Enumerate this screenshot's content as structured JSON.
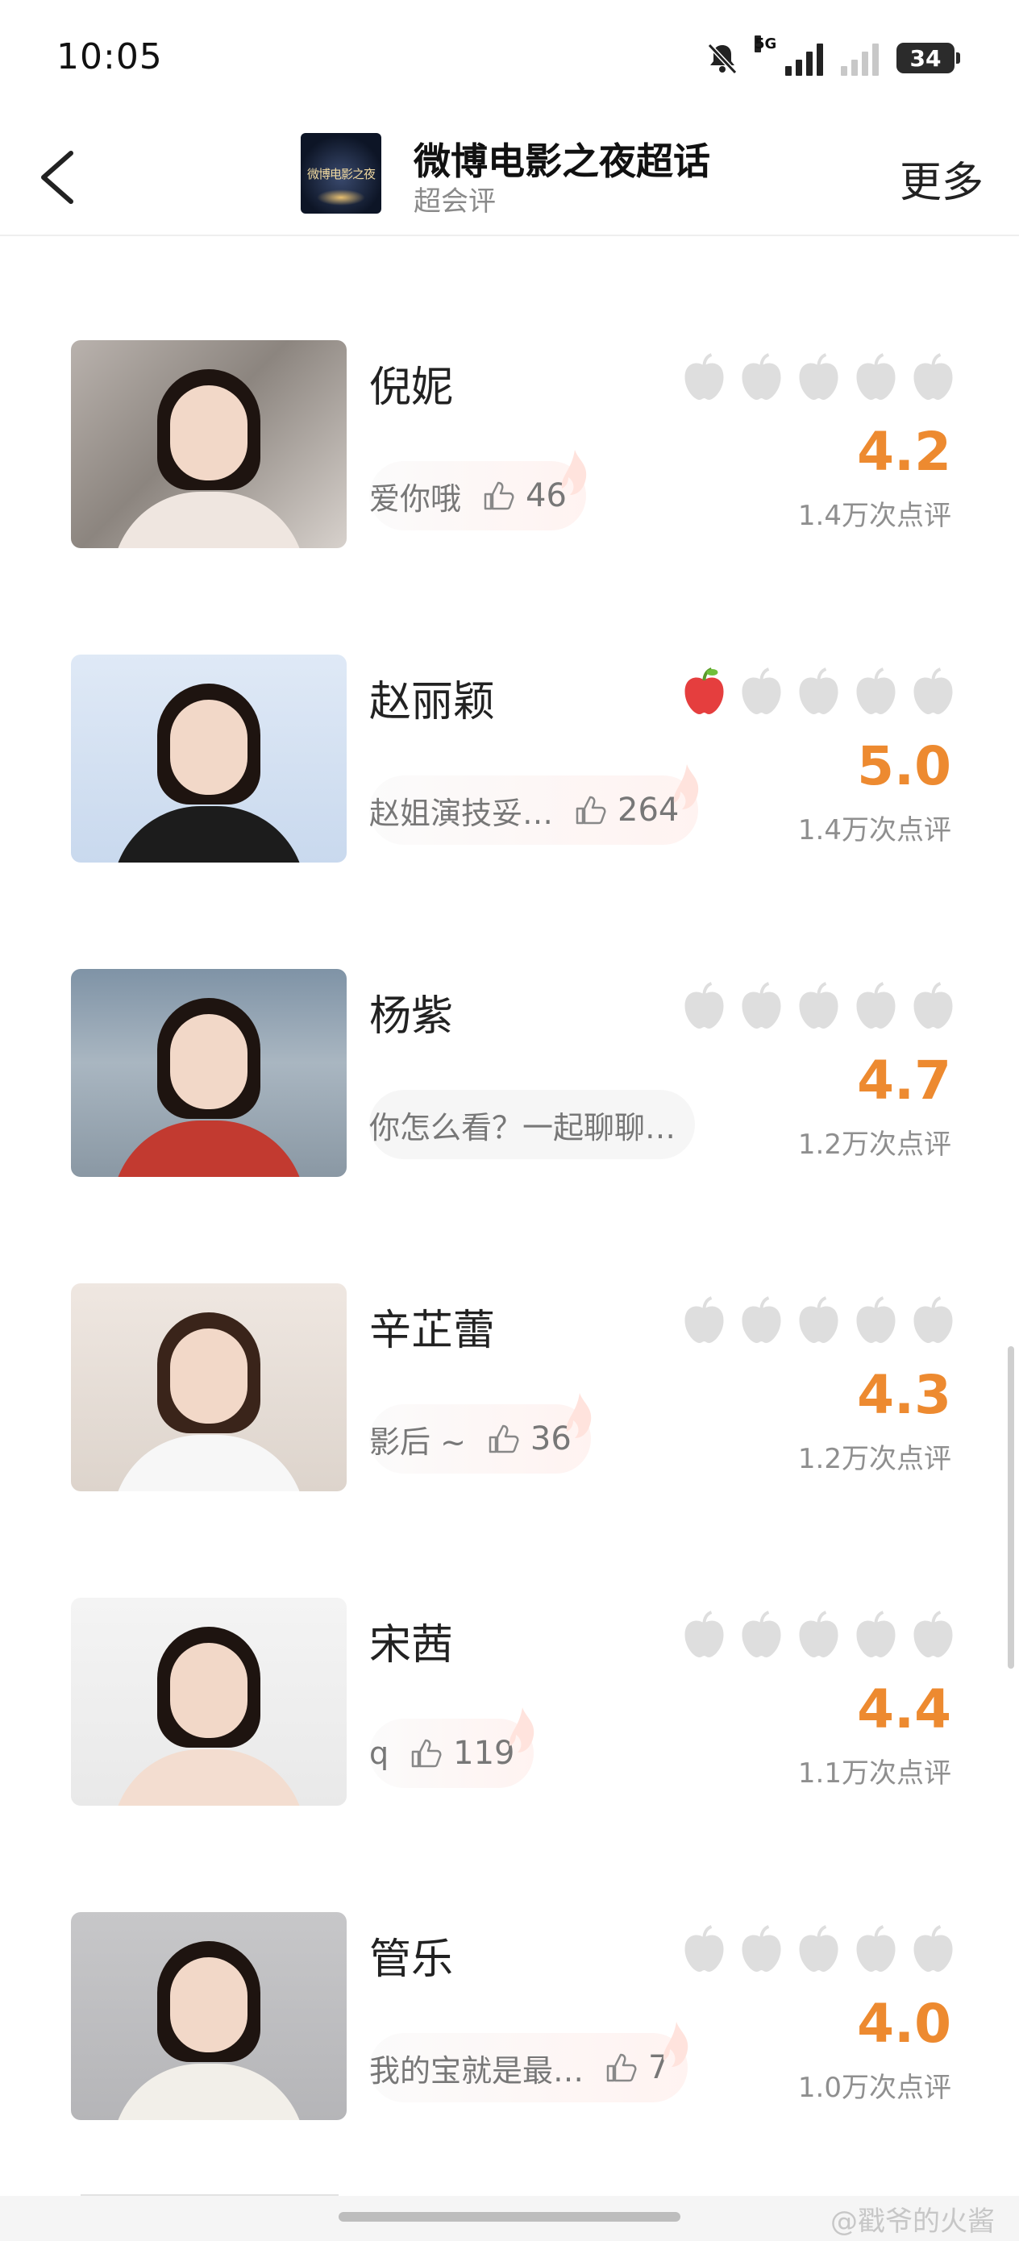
{
  "status_bar": {
    "time": "10:05",
    "network_label": "5G",
    "battery": "34"
  },
  "header": {
    "logo_text": "微博电影之夜",
    "title": "微博电影之夜超话",
    "subtitle": "超会评",
    "more_label": "更多"
  },
  "colors": {
    "score_orange": "#ed8a30",
    "apple_filled": "#e53e3e",
    "apple_empty": "#dedede"
  },
  "items": [
    {
      "name": "倪妮",
      "comment": "爱你哦",
      "likes": "46",
      "score": "4.2",
      "reviews": "1.4万次点评",
      "rating_apples": 0
    },
    {
      "name": "赵丽颖",
      "comment": "赵姐演技妥…",
      "likes": "264",
      "score": "5.0",
      "reviews": "1.4万次点评",
      "rating_apples": 1
    },
    {
      "name": "杨紫",
      "comment": "你怎么看？一起聊聊…",
      "likes": "",
      "score": "4.7",
      "reviews": "1.2万次点评",
      "rating_apples": 0
    },
    {
      "name": "辛芷蕾",
      "comment": "影后 ~",
      "likes": "36",
      "score": "4.3",
      "reviews": "1.2万次点评",
      "rating_apples": 0
    },
    {
      "name": "宋茜",
      "comment": "q",
      "likes": "119",
      "score": "4.4",
      "reviews": "1.1万次点评",
      "rating_apples": 0
    },
    {
      "name": "管乐",
      "comment": "我的宝就是最…",
      "likes": "7",
      "score": "4.0",
      "reviews": "1.0万次点评",
      "rating_apples": 0
    }
  ],
  "watermark": "@戳爷的火酱"
}
